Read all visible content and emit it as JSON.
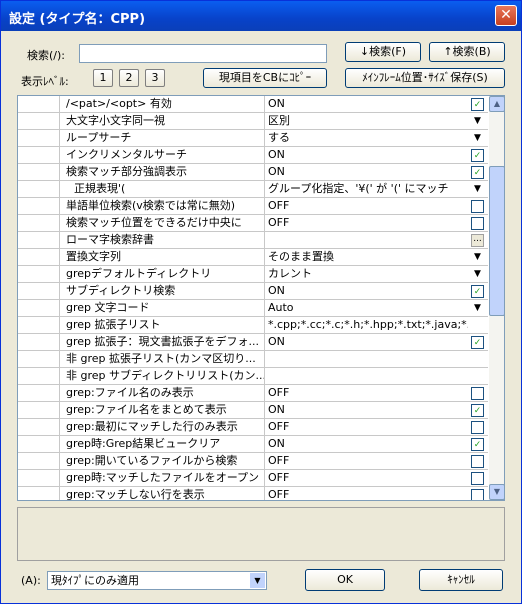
{
  "window": {
    "title": "設定 (タイプ名：CPP)",
    "close_glyph": "✕"
  },
  "search": {
    "label": "検索(/):",
    "value": "",
    "down_button": "↓検索(F)",
    "up_button": "↑検索(B)"
  },
  "display_level": {
    "label": "表示ﾚﾍﾞﾙ:",
    "levels": [
      "1",
      "2",
      "3"
    ],
    "copy_button": "現項目をCBにｺﾋﾟｰ",
    "save_button": "ﾒｲﾝﾌﾚｰﾑ位置･ｻｲｽﾞ保存(S)"
  },
  "rows": [
    {
      "name": "/<pat>/<opt> 有効",
      "value": "ON",
      "control": "check",
      "checked": true
    },
    {
      "name": "大文字小文字同一視",
      "value": "区別",
      "control": "dropdown"
    },
    {
      "name": "ループサーチ",
      "value": "する",
      "control": "dropdown"
    },
    {
      "name": "インクリメンタルサーチ",
      "value": "ON",
      "control": "check",
      "checked": true
    },
    {
      "name": "検索マッチ部分強調表示",
      "value": "ON",
      "control": "check",
      "checked": true
    },
    {
      "name": "正規表現'(",
      "value": "グループ化指定、'¥(' が '(' にマッチ",
      "control": "dropdown",
      "indent": true
    },
    {
      "name": "単語単位検索(v検索では常に無効)",
      "value": "OFF",
      "control": "check",
      "checked": false
    },
    {
      "name": "検索マッチ位置をできるだけ中央に",
      "value": "OFF",
      "control": "check",
      "checked": false
    },
    {
      "name": "ローマ字検索辞書",
      "value": "",
      "control": "ellipsis"
    },
    {
      "name": "置換文字列",
      "value": "そのまま置換",
      "control": "dropdown"
    },
    {
      "name": "grepデフォルトディレクトリ",
      "value": "カレント",
      "control": "dropdown"
    },
    {
      "name": "サブディレクトリ検索",
      "value": "ON",
      "control": "check",
      "checked": true
    },
    {
      "name": "grep 文字コード",
      "value": "Auto",
      "control": "dropdown"
    },
    {
      "name": "grep 拡張子リスト",
      "value": "*.cpp;*.cc;*.c;*.h;*.hpp;*.txt;*.java;*.htm...",
      "control": "none"
    },
    {
      "name": "grep 拡張子：現文書拡張子をデフォ...",
      "value": "ON",
      "control": "check",
      "checked": true
    },
    {
      "name": "非 grep 拡張子リスト(カンマ区切り...",
      "value": "",
      "control": "none"
    },
    {
      "name": "非 grep サブディレクトリリスト(カン...",
      "value": "",
      "control": "none"
    },
    {
      "name": "grep:ファイル名のみ表示",
      "value": "OFF",
      "control": "check",
      "checked": false
    },
    {
      "name": "grep:ファイル名をまとめて表示",
      "value": "ON",
      "control": "check",
      "checked": true
    },
    {
      "name": "grep:最初にマッチした行のみ表示",
      "value": "OFF",
      "control": "check",
      "checked": false
    },
    {
      "name": "grep時:Grep結果ビュークリア",
      "value": "ON",
      "control": "check",
      "checked": true
    },
    {
      "name": "grep:開いているファイルから検索",
      "value": "OFF",
      "control": "check",
      "checked": false
    },
    {
      "name": "grep時:マッチしたファイルをオープン",
      "value": "OFF",
      "control": "check",
      "checked": false
    },
    {
      "name": "grep:マッチしない行を表示",
      "value": "OFF",
      "control": "check",
      "checked": false
    }
  ],
  "icons": {
    "check": "✓",
    "dropdown": "▼",
    "ellipsis": "...",
    "scroll_up": "▲",
    "scroll_down": "▼"
  },
  "footer": {
    "apply_label": "(A):",
    "apply_value": "現ﾀｲﾌﾟにのみ適用",
    "ok_button": "OK",
    "cancel_button": "ｷｬﾝｾﾙ"
  }
}
